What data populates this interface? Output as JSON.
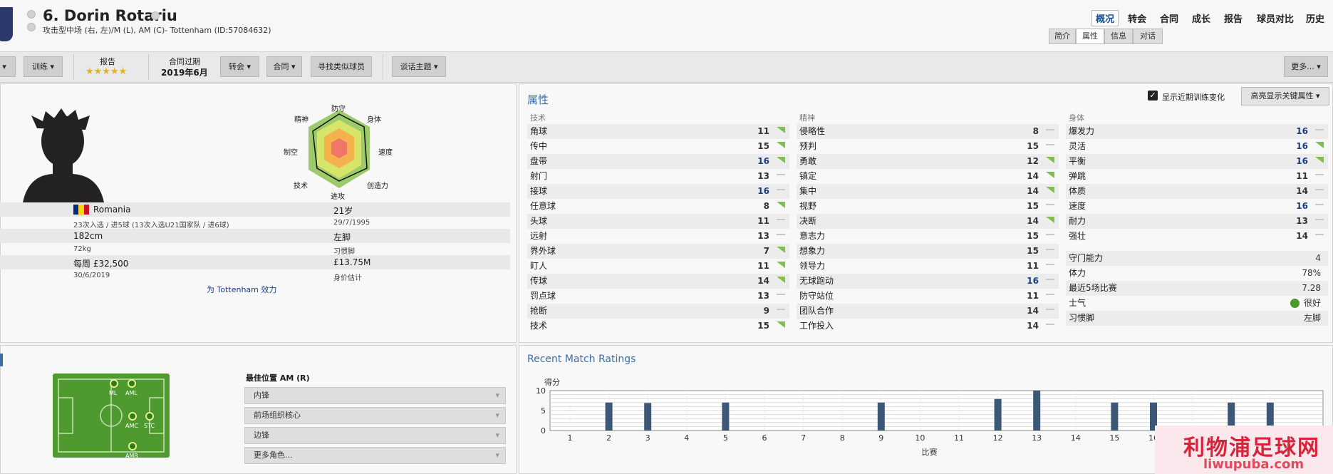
{
  "header": {
    "title": "6. Dorin Rotariu",
    "subtitle": "攻击型中场 (右, 左)/M (L), AM (C)- Tottenham (ID:57084632)",
    "nav": [
      "概况",
      "转会",
      "合同",
      "成长",
      "报告",
      "球员对比",
      "历史"
    ],
    "subtabs": [
      "简介",
      "属性",
      "信息",
      "对话"
    ]
  },
  "toolbar": {
    "btn_cut": "",
    "train": "训练",
    "report_label": "报告",
    "stars": "★★★★★",
    "contract_label": "合同过期",
    "contract_value": "2019年6月",
    "transfer": "转会",
    "contract": "合同",
    "find_similar": "寻找类似球员",
    "talk": "谈话主题",
    "more": "更多..."
  },
  "radar": {
    "defense": "防守",
    "physical": "身体",
    "mental": "精神",
    "speed": "速度",
    "aerial": "制空",
    "technique": "技术",
    "creativity": "创造力",
    "attack": "进攻"
  },
  "info": {
    "nation": "Romania",
    "caps": "23次入选 / 进5球 (13次入选U21国家队 / 进6球)",
    "age": "21岁",
    "dob": "29/7/1995",
    "height": "182cm",
    "foot": "左脚",
    "weight": "72kg",
    "foot_label": "习惯脚",
    "wage": "每周 £32,500",
    "value": "£13.75M",
    "contract_end": "30/6/2019",
    "value_label": "身价估计",
    "plays_for": "为 Tottenham 效力"
  },
  "attributes": {
    "title": "属性",
    "show_training": "显示近期训练变化",
    "highlight": "高亮显示关键属性",
    "technical_h": "技术",
    "mental_h": "精神",
    "physical_h": "身体",
    "technical": [
      {
        "n": "角球",
        "v": "11",
        "t": "up"
      },
      {
        "n": "传中",
        "v": "15",
        "t": "up"
      },
      {
        "n": "盘带",
        "v": "16",
        "t": "up"
      },
      {
        "n": "射门",
        "v": "13",
        "t": "flat"
      },
      {
        "n": "接球",
        "v": "16",
        "t": "flat"
      },
      {
        "n": "任意球",
        "v": "8",
        "t": "up"
      },
      {
        "n": "头球",
        "v": "11",
        "t": "flat"
      },
      {
        "n": "远射",
        "v": "13",
        "t": "flat"
      },
      {
        "n": "界外球",
        "v": "7",
        "t": "up"
      },
      {
        "n": "盯人",
        "v": "11",
        "t": "up"
      },
      {
        "n": "传球",
        "v": "14",
        "t": "up"
      },
      {
        "n": "罚点球",
        "v": "13",
        "t": "flat"
      },
      {
        "n": "抢断",
        "v": "9",
        "t": "flat"
      },
      {
        "n": "技术",
        "v": "15",
        "t": "up"
      }
    ],
    "mental": [
      {
        "n": "侵略性",
        "v": "8",
        "t": "flat"
      },
      {
        "n": "预判",
        "v": "15",
        "t": "flat"
      },
      {
        "n": "勇敢",
        "v": "12",
        "t": "up"
      },
      {
        "n": "镇定",
        "v": "14",
        "t": "up"
      },
      {
        "n": "集中",
        "v": "14",
        "t": "up"
      },
      {
        "n": "视野",
        "v": "15",
        "t": "flat"
      },
      {
        "n": "决断",
        "v": "14",
        "t": "up"
      },
      {
        "n": "意志力",
        "v": "15",
        "t": "flat"
      },
      {
        "n": "想象力",
        "v": "15",
        "t": "flat"
      },
      {
        "n": "领导力",
        "v": "11",
        "t": "flat"
      },
      {
        "n": "无球跑动",
        "v": "16",
        "t": "flat"
      },
      {
        "n": "防守站位",
        "v": "11",
        "t": "flat"
      },
      {
        "n": "团队合作",
        "v": "14",
        "t": "flat"
      },
      {
        "n": "工作投入",
        "v": "14",
        "t": "flat"
      }
    ],
    "physical": [
      {
        "n": "爆发力",
        "v": "16",
        "t": "flat"
      },
      {
        "n": "灵活",
        "v": "16",
        "t": "up"
      },
      {
        "n": "平衡",
        "v": "16",
        "t": "up"
      },
      {
        "n": "弹跳",
        "v": "11",
        "t": "flat"
      },
      {
        "n": "体质",
        "v": "14",
        "t": "flat"
      },
      {
        "n": "速度",
        "v": "16",
        "t": "flat"
      },
      {
        "n": "耐力",
        "v": "13",
        "t": "flat"
      },
      {
        "n": "强壮",
        "v": "14",
        "t": "flat"
      }
    ],
    "extra": [
      {
        "n": "守门能力",
        "v": "4"
      },
      {
        "n": "体力",
        "v": "78%"
      },
      {
        "n": "最近5场比赛",
        "v": "7.28"
      },
      {
        "n": "士气",
        "v": "很好"
      },
      {
        "n": "习惯脚",
        "v": "左脚"
      }
    ]
  },
  "positions": {
    "best_label": "最佳位置 AM (R)",
    "dots": [
      "ML",
      "AML",
      "AMC",
      "STC",
      "AMR"
    ],
    "roles": [
      "内锋",
      "前场组织核心",
      "边锋",
      "更多角色..."
    ]
  },
  "ratings": {
    "title": "Recent Match Ratings",
    "ylabel": "得分",
    "xlabel": "比赛"
  },
  "chart_data": {
    "type": "bar",
    "title": "Recent Match Ratings",
    "xlabel": "比赛",
    "ylabel": "得分",
    "ylim": [
      0,
      10
    ],
    "y_ticks": [
      0,
      5,
      10
    ],
    "categories": [
      "1",
      "2",
      "3",
      "4",
      "5",
      "6",
      "7",
      "8",
      "9",
      "10",
      "11",
      "12",
      "13",
      "14",
      "15",
      "16",
      "17",
      "18",
      "19"
    ],
    "values": [
      null,
      7.0,
      6.9,
      null,
      7.0,
      null,
      null,
      null,
      7.0,
      null,
      null,
      7.9,
      10.0,
      null,
      7.0,
      7.0,
      null,
      7.0,
      7.0
    ],
    "grid": true
  },
  "colors": {
    "accent": "#3c6ea3",
    "bar": "#3d5876",
    "trend_up": "#7fc04d",
    "pitch": "#4e9a2f"
  }
}
